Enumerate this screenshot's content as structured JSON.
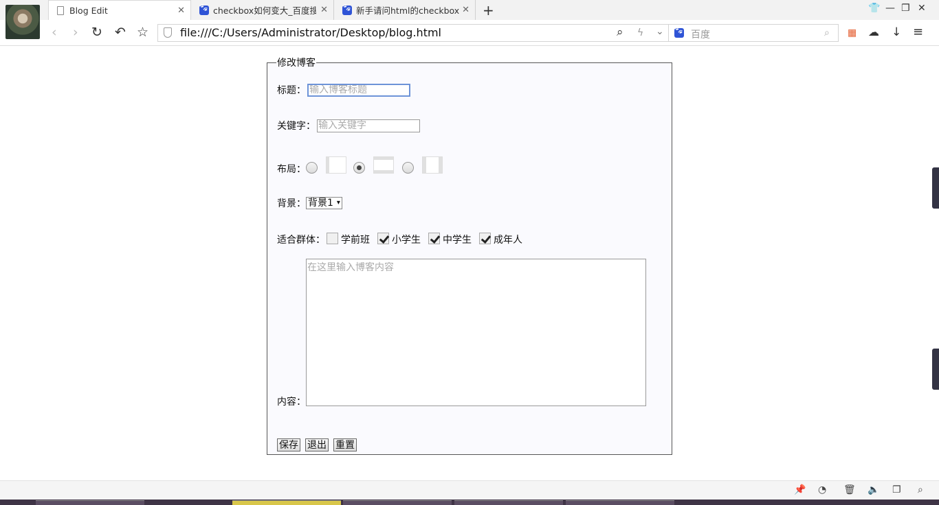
{
  "tabs": [
    {
      "title": "Blog Edit",
      "icon": "page-icon"
    },
    {
      "title": "checkbox如何变大_百度搜索",
      "icon": "baidu-icon"
    },
    {
      "title": "新手请问html的checkbox怎么",
      "icon": "baidu-icon"
    }
  ],
  "address": {
    "url": "file:///C:/Users/Administrator/Desktop/blog.html"
  },
  "search": {
    "placeholder": "百度"
  },
  "form": {
    "legend": "修改博客",
    "title_label": "标题：",
    "title_placeholder": "输入博客标题",
    "keyword_label": "关键字：",
    "keyword_placeholder": "输入关键字",
    "layout_label": "布局：",
    "layout_selected": 2,
    "background_label": "背景：",
    "background_value": "背景1",
    "audience_label": "适合群体：",
    "audience": [
      {
        "label": "学前班",
        "checked": false
      },
      {
        "label": "小学生",
        "checked": true
      },
      {
        "label": "中学生",
        "checked": true
      },
      {
        "label": "成年人",
        "checked": true
      }
    ],
    "content_label": "内容：",
    "content_placeholder": "在这里输入博客内容",
    "buttons": {
      "save": "保存",
      "exit": "退出",
      "reset": "重置"
    }
  },
  "colors": {
    "accent_focus": "#6d93d8",
    "baidu_blue": "#2f54d6",
    "fieldset_bg": "#fafafe"
  }
}
